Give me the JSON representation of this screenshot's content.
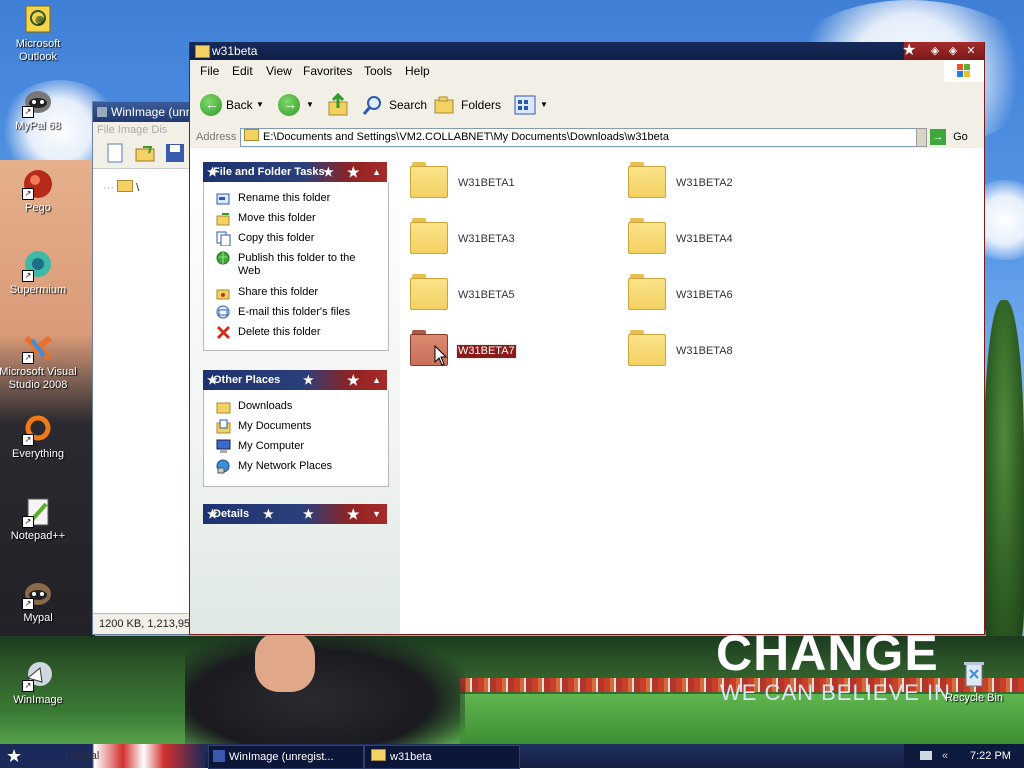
{
  "desktop": {
    "icons": [
      {
        "label": "Microsoft Outlook"
      },
      {
        "label": "MyPal 68"
      },
      {
        "label": "Pego"
      },
      {
        "label": "Supermium"
      },
      {
        "label": "Microsoft Visual Studio 2008"
      },
      {
        "label": "Everything"
      },
      {
        "label": "Notepad++"
      },
      {
        "label": "Mypal"
      },
      {
        "label": "WinImage"
      },
      {
        "label": "Recycle Bin"
      }
    ],
    "wallpaper_text_1": "CHANGE",
    "wallpaper_text_2": "WE CAN BELIEVE IN"
  },
  "winimage": {
    "title": "WinImage (unre",
    "menu": "File  Image  Dis",
    "tree_root": "\\",
    "status": "1200 KB, 1,213,95"
  },
  "explorer": {
    "title": "w31beta",
    "menu": [
      "File",
      "Edit",
      "View",
      "Favorites",
      "Tools",
      "Help"
    ],
    "toolbar": {
      "back": "Back",
      "search": "Search",
      "folders": "Folders"
    },
    "address_label": "Address",
    "address_value": "E:\\Documents and Settings\\VM2.COLLABNET\\My Documents\\Downloads\\w31beta",
    "go": "Go",
    "panes": {
      "tasks": {
        "title": "File and Folder Tasks",
        "items": [
          "Rename this folder",
          "Move this folder",
          "Copy this folder",
          "Publish this folder to the Web",
          "Share this folder",
          "E-mail this folder's files",
          "Delete this folder"
        ]
      },
      "places": {
        "title": "Other Places",
        "items": [
          "Downloads",
          "My Documents",
          "My Computer",
          "My Network Places"
        ]
      },
      "details": {
        "title": "Details"
      }
    },
    "folders": [
      {
        "name": "W31BETA1",
        "selected": false
      },
      {
        "name": "W31BETA2",
        "selected": false
      },
      {
        "name": "W31BETA3",
        "selected": false
      },
      {
        "name": "W31BETA4",
        "selected": false
      },
      {
        "name": "W31BETA5",
        "selected": false
      },
      {
        "name": "W31BETA6",
        "selected": false
      },
      {
        "name": "W31BETA7",
        "selected": true
      },
      {
        "name": "W31BETA8",
        "selected": false
      }
    ],
    "colors": {
      "folder": "#f3d162",
      "folder_selected": "#c8705a",
      "selection": "#8c1a1a"
    }
  },
  "taskbar": {
    "start_label": "Mypal",
    "buttons": [
      {
        "label": "WinImage (unregist..."
      },
      {
        "label": "w31beta"
      }
    ],
    "clock": "7:22 PM"
  }
}
